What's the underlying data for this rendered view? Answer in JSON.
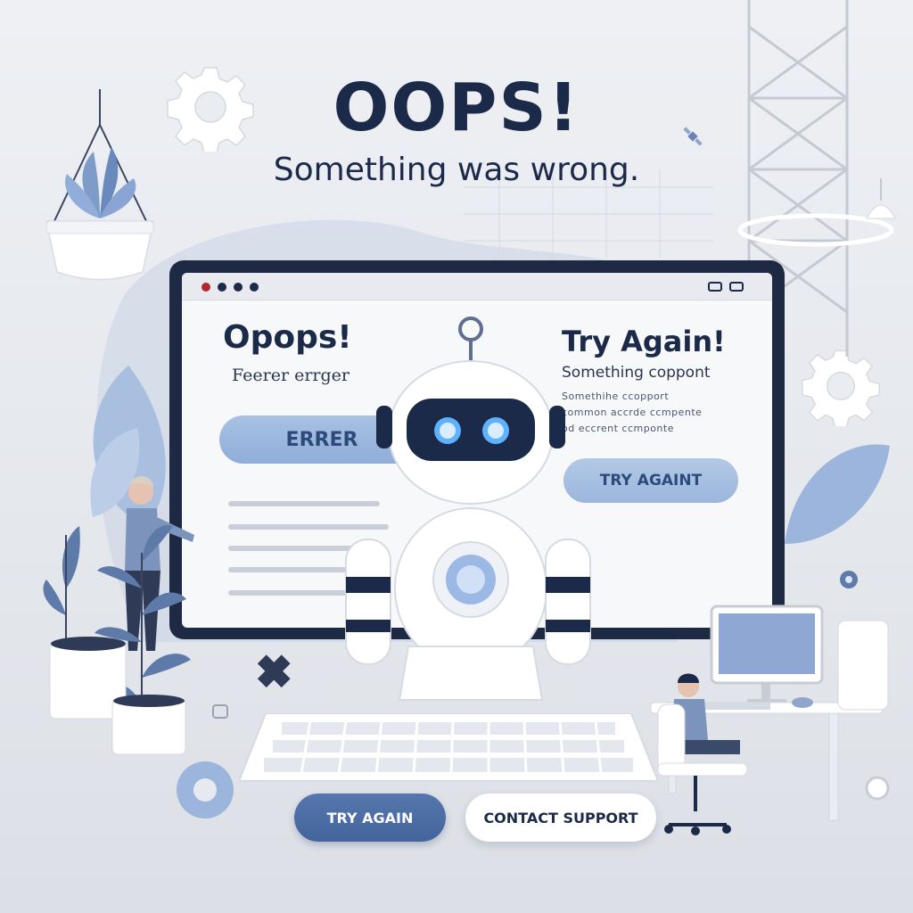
{
  "header": {
    "title": "OOPS!",
    "subtitle": "Something was wrong."
  },
  "screen": {
    "title": "Opops!",
    "subtitle": "Feerer errger",
    "error_button": "ERRER",
    "right_title": "Try Again!",
    "right_subtitle": "Something coppont",
    "right_lines": [
      "Somethihe ccopport",
      "common accrde ccmpente",
      "od eccrent ccmponte"
    ],
    "try_button": "TRY AGAINT"
  },
  "actions": {
    "try_again": "TRY AGAIN",
    "contact_support": "CONTACT SUPPORT"
  },
  "colors": {
    "navy": "#1c2a4a",
    "accent_blue": "#5577ad",
    "light_blue": "#a9c2e4",
    "background": "#e9ecf0"
  }
}
